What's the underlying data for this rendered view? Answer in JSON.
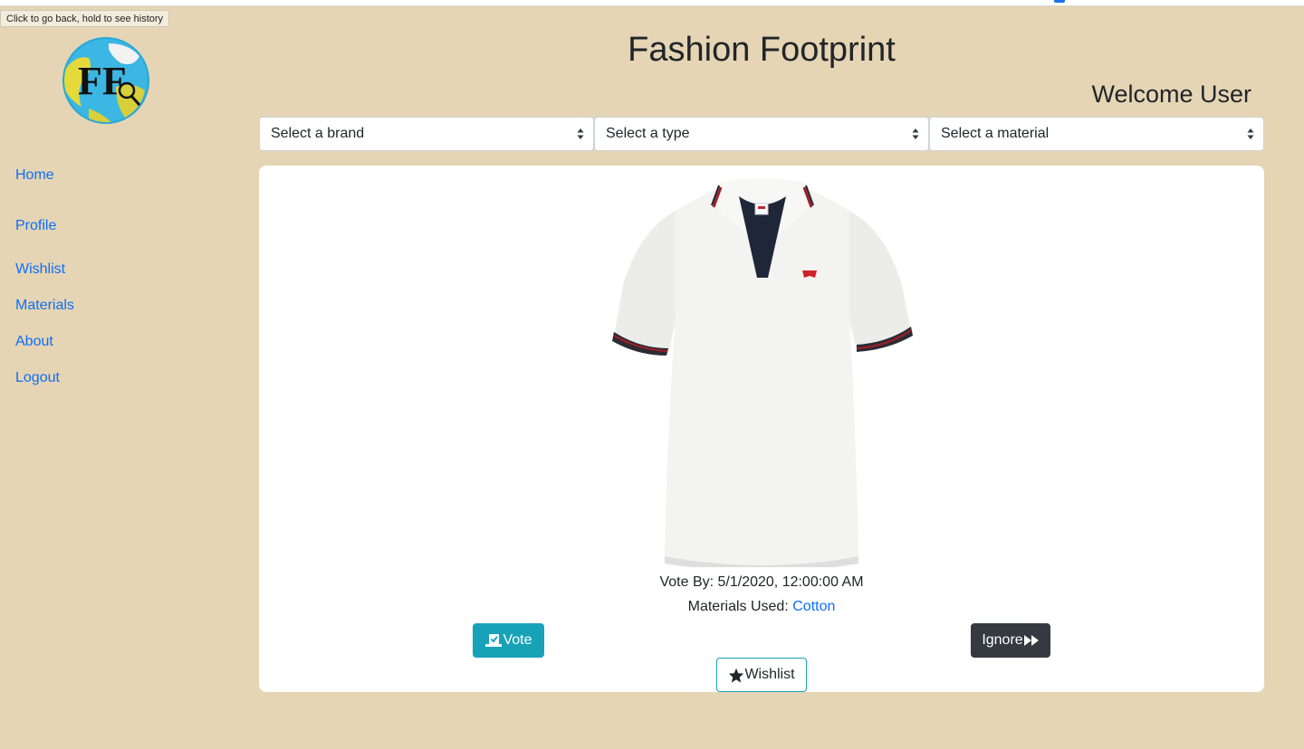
{
  "browser": {
    "tooltip": "Click to go back, hold to see history"
  },
  "logo": {
    "text": "FF",
    "icon": "globe-logo-icon"
  },
  "sidebar": {
    "items": [
      {
        "label": "Home"
      },
      {
        "label": "Profile"
      },
      {
        "label": "Wishlist"
      },
      {
        "label": "Materials"
      },
      {
        "label": "About"
      },
      {
        "label": "Logout"
      }
    ]
  },
  "header": {
    "title": "Fashion Footprint",
    "welcome": "Welcome User"
  },
  "filters": {
    "brand": "Select a brand",
    "type": "Select a type",
    "material": "Select a material"
  },
  "product": {
    "image": "white-polo-shirt",
    "vote_by_label": "Vote By:",
    "vote_by_value": "5/1/2020, 12:00:00 AM",
    "materials_label": "Materials Used:",
    "materials_value": "Cotton"
  },
  "actions": {
    "vote": "Vote",
    "ignore": "Ignore",
    "wishlist": "Wishlist"
  },
  "colors": {
    "background": "#e5d5b4",
    "link": "#0d6efd",
    "vote_button": "#17a2b8",
    "ignore_button": "#343a40"
  }
}
